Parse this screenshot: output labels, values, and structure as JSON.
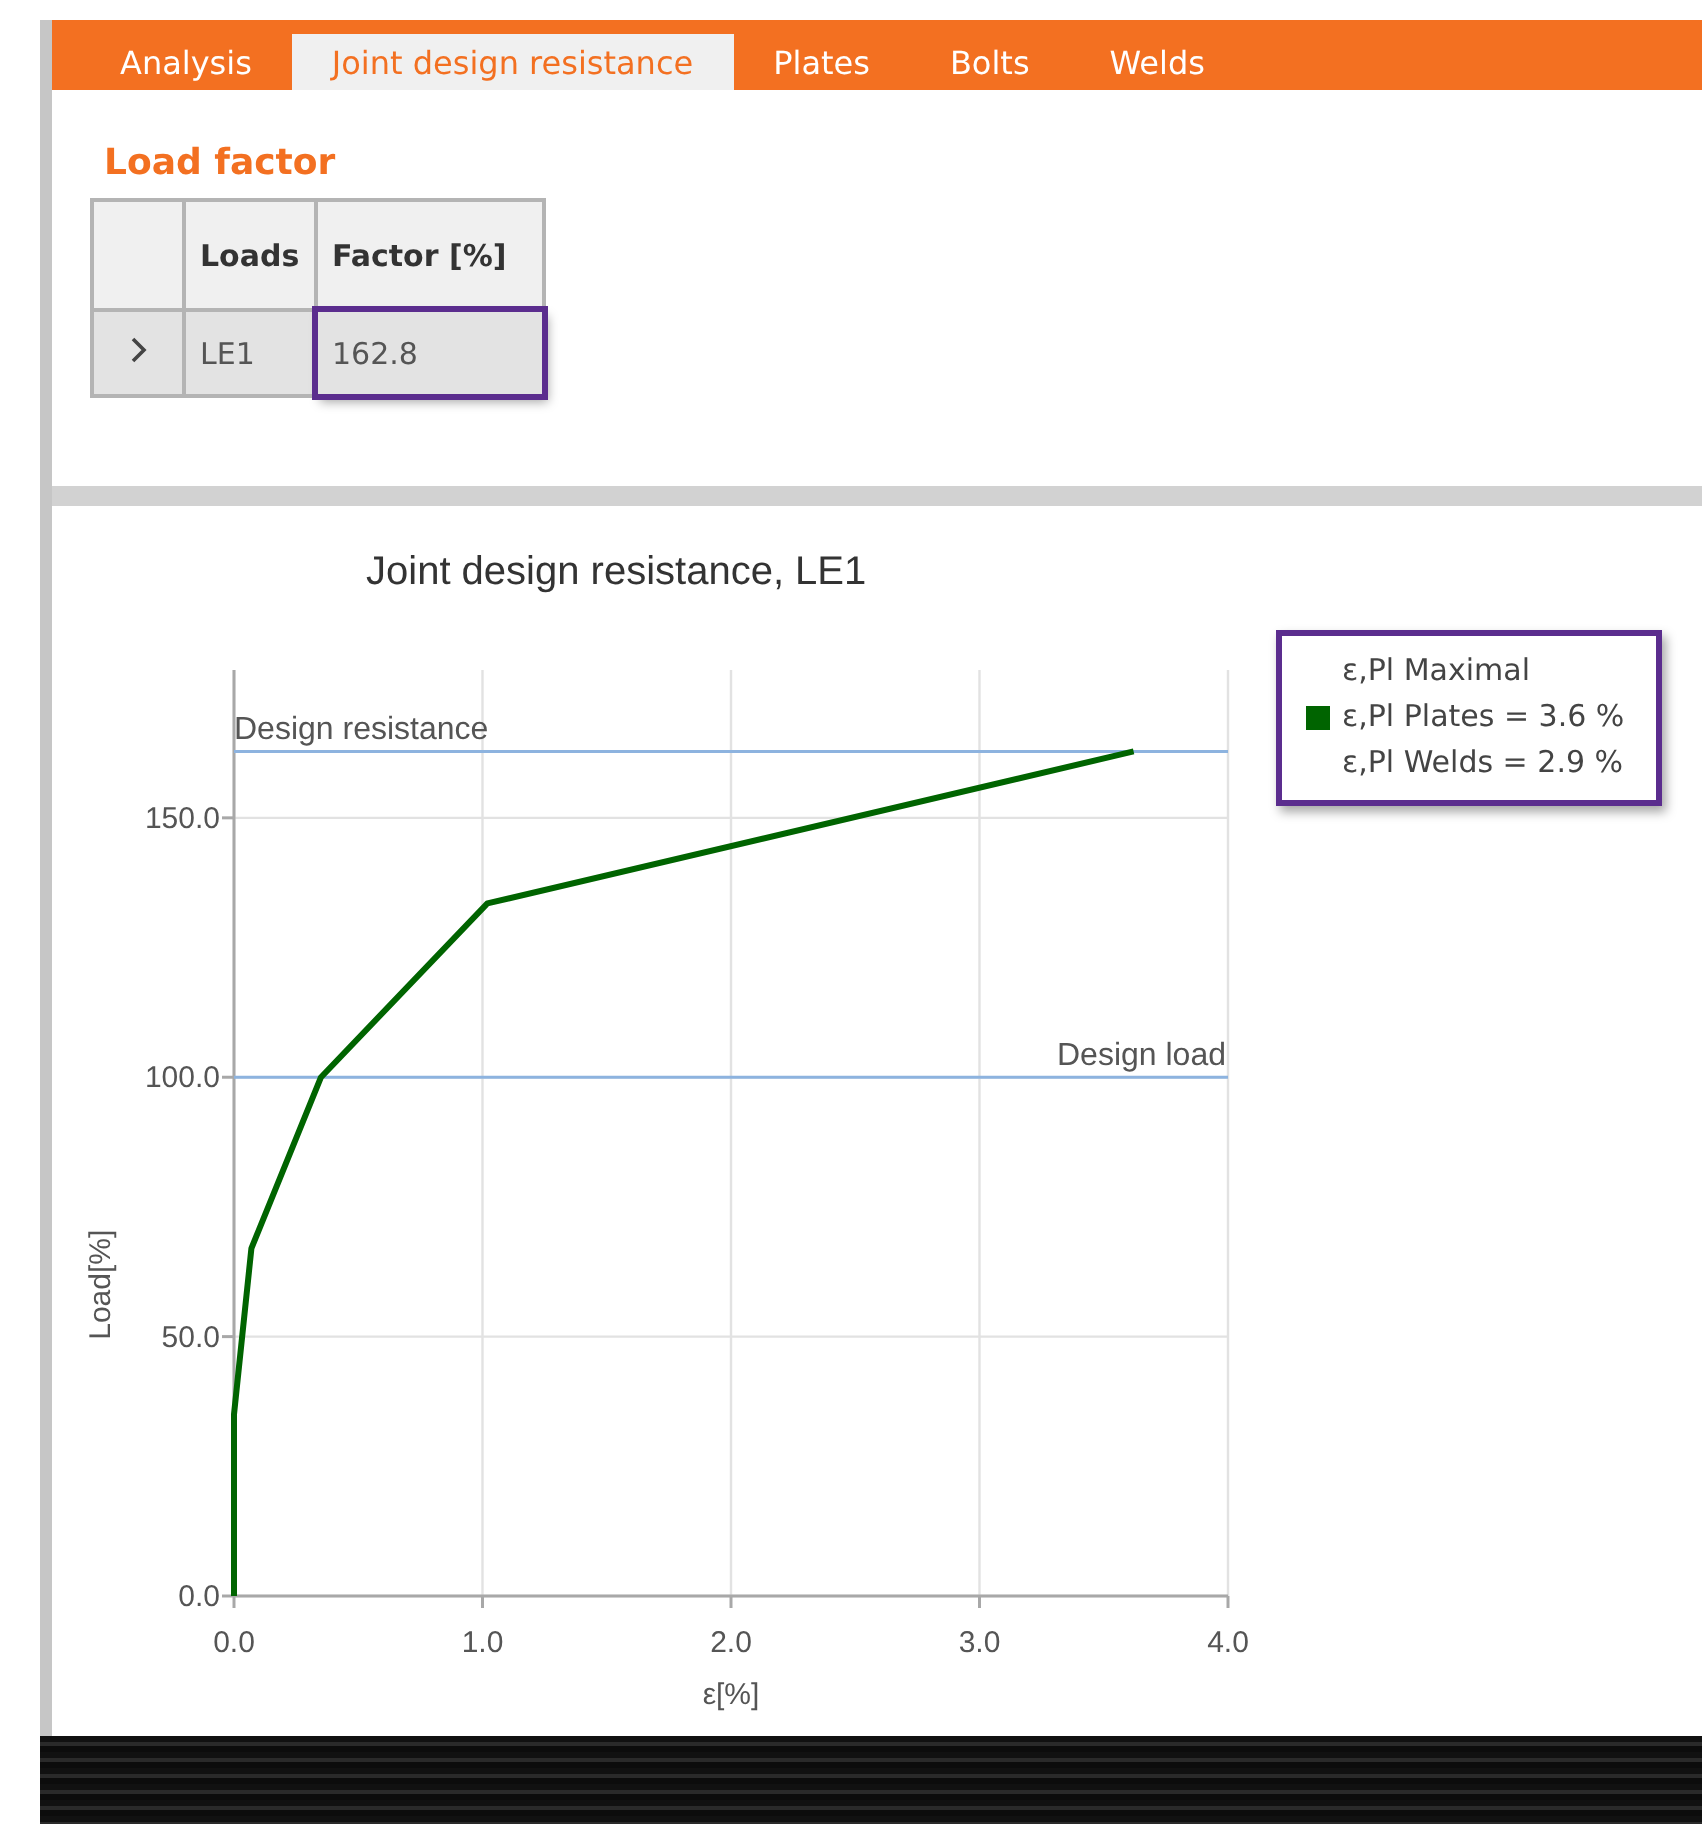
{
  "tabs": [
    {
      "label": "Analysis",
      "selected": false
    },
    {
      "label": "Joint design resistance",
      "selected": true
    },
    {
      "label": "Plates",
      "selected": false
    },
    {
      "label": "Bolts",
      "selected": false
    },
    {
      "label": "Welds",
      "selected": false
    }
  ],
  "load_factor": {
    "title": "Load factor",
    "columns": [
      "Loads",
      "Factor [%]"
    ],
    "rows": [
      {
        "load": "LE1",
        "factor": "162.8",
        "factor_highlighted": true
      }
    ]
  },
  "chart": {
    "legend_highlighted": true,
    "legend": [
      {
        "label": "ε,Pl Maximal"
      },
      {
        "label": "ε,Pl Plates = 3.6 %",
        "color": "#006400"
      },
      {
        "label": "ε,Pl Welds = 2.9 %"
      }
    ],
    "chart_data": {
      "type": "line",
      "title": "Joint design resistance, LE1",
      "xlabel": "ε[%]",
      "ylabel": "Load[%]",
      "x": [
        0,
        0,
        0.07,
        0.35,
        1.02,
        3.62
      ],
      "series": [
        {
          "color": "#006400",
          "values": [
            0,
            35,
            67,
            100,
            133.5,
            162.8
          ]
        }
      ],
      "xlim": [
        0,
        4
      ],
      "ylim": [
        0,
        178.5
      ],
      "xticks": [
        {
          "value": 0,
          "label": "0.0"
        },
        {
          "value": 1,
          "label": "1.0"
        },
        {
          "value": 2,
          "label": "2.0"
        },
        {
          "value": 3,
          "label": "3.0"
        },
        {
          "value": 4,
          "label": "4.0"
        }
      ],
      "yticks": [
        {
          "value": 0,
          "label": "0.0"
        },
        {
          "value": 50,
          "label": "50.0"
        },
        {
          "value": 100,
          "label": "100.0"
        },
        {
          "value": 150,
          "label": "150.0"
        }
      ],
      "grid": true,
      "ref_lines": [
        {
          "axis": "y",
          "value": 162.8,
          "label": "Design resistance"
        },
        {
          "axis": "y",
          "value": 100,
          "label": "Design load"
        }
      ]
    }
  }
}
